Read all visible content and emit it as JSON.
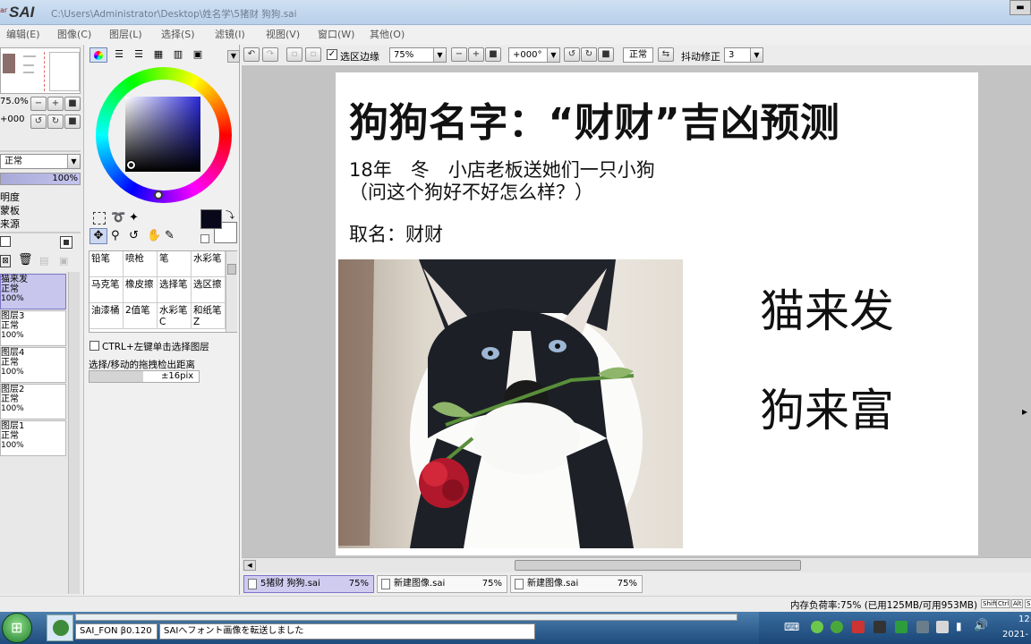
{
  "window": {
    "app_logo": "SAI",
    "title": "C:\\Users\\Administrator\\Desktop\\姓名学\\5猪财 狗狗.sai"
  },
  "menu": [
    "编辑(E)",
    "图像(C)",
    "图层(L)",
    "选择(S)",
    "滤镜(I)",
    "视图(V)",
    "窗口(W)",
    "其他(O)"
  ],
  "toolbar": {
    "selection_edge_label": "选区边缘",
    "selection_edge_checked": true,
    "zoom_value": "75%",
    "rotation_value": "+000°",
    "blend_mode": "正常",
    "stabilizer_label": "抖动修正",
    "stabilizer_value": "3"
  },
  "navigator": {
    "zoom_value": "75.0%",
    "rotation_value": "+000"
  },
  "layer_panel": {
    "blend_mode": "正常",
    "opacity": "100%",
    "options": [
      "明度",
      "蒙板",
      "来源"
    ],
    "layers": [
      {
        "name": "猫来发",
        "mode": "正常",
        "opacity": "100%",
        "selected": true
      },
      {
        "name": "图层3",
        "mode": "正常",
        "opacity": "100%",
        "selected": false
      },
      {
        "name": "图层4",
        "mode": "正常",
        "opacity": "100%",
        "selected": false
      },
      {
        "name": "图层2",
        "mode": "正常",
        "opacity": "100%",
        "selected": false
      },
      {
        "name": "图层1",
        "mode": "正常",
        "opacity": "100%",
        "selected": false
      }
    ]
  },
  "brushes": [
    [
      "铅笔",
      "喷枪",
      "笔",
      "水彩笔"
    ],
    [
      "马克笔",
      "橡皮擦",
      "选择笔",
      "选区擦"
    ],
    [
      "油漆桶",
      "2值笔",
      "水彩笔C",
      "和纸笔Z"
    ]
  ],
  "tool_options": {
    "ctrl_select_label": "CTRL+左键单击选择图层",
    "detect_label": "选择/移动的拖拽检出距离",
    "detect_value": "±16pix"
  },
  "canvas": {
    "title": "狗狗名字：“财财”吉凶预测",
    "line1": "18年　冬　小店老板送她们一只小狗",
    "line2": "（问这个狗好不好怎么样？）",
    "name_line": "取名：财财",
    "phrase1": "猫来发",
    "phrase2": "狗来富"
  },
  "tabs": [
    {
      "name": "5猪财 狗狗.sai",
      "zoom": "75%",
      "active": true
    },
    {
      "name": "新建图像.sai",
      "zoom": "75%",
      "active": false
    },
    {
      "name": "新建图像.sai",
      "zoom": "75%",
      "active": false
    }
  ],
  "status": {
    "memory": "内存负荷率:75% (已用125MB/可用953MB)",
    "keys": [
      "Shift",
      "Ctrl",
      "Alt",
      "S"
    ]
  },
  "taskbar": {
    "task1": "SAI_FON β0.120",
    "task2": "SAIへフォント画像を転送しました",
    "time": "12:",
    "date": "2021-"
  },
  "colors": {
    "accent": "#3a38c8",
    "selected_layer": "#c9c6ee",
    "workspace": "#c0c0c0",
    "taskbar": "#0e3f6e"
  }
}
